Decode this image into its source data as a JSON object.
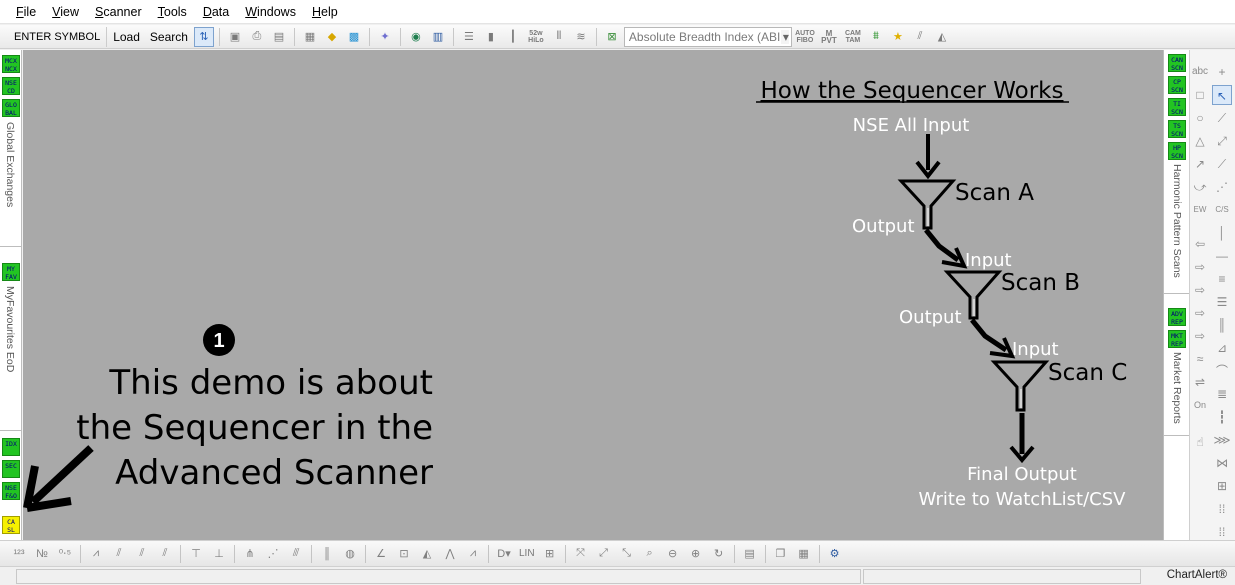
{
  "menu": {
    "items": [
      "File",
      "View",
      "Scanner",
      "Tools",
      "Data",
      "Windows",
      "Help"
    ]
  },
  "toolbar": {
    "symbol_label": "ENTER SYMBOL",
    "load_label": "Load",
    "search_label": "Search",
    "indicator_select": "Absolute Breadth Index (ABI",
    "small_icons": {
      "w52": "52w\nHiLo",
      "autofibo": "AUTO\nFIBO",
      "mpvt": "M\nPVT",
      "camtam": "CAM\nTAM"
    }
  },
  "left_panel": {
    "buttons": {
      "mcx": "MCX\nNCX",
      "nsecd": "NSE\nCD",
      "global": "GLO\nBAL",
      "myfav": "MY\nFAV",
      "idx": "IDX",
      "sec": "SEC",
      "nsefo": "NSE\nF&O",
      "casl": "CA\nSL"
    },
    "section_global": "Global Exchanges",
    "section_favourites": "MyFavourites EoD"
  },
  "right_panel": {
    "buttons": {
      "cnscn": "CAN\nSCN",
      "cpscn": "CP\nSCN",
      "tiscn": "TI\nSCN",
      "tsscn": "TS\nSCN",
      "hpscn": "HP\nSCN",
      "advrep": "ADV\nREP",
      "mktrep": "MKT\nREP"
    },
    "section_harmonic": "Harmonic Pattern Scans",
    "section_market": "Market Reports"
  },
  "canvas": {
    "step_number": "1",
    "demo_lines": [
      "This demo is about",
      "the Sequencer in the",
      "Advanced Scanner"
    ],
    "diagram": {
      "title": "How the Sequencer Works",
      "start_label": "NSE All Input",
      "scan_a": "Scan A",
      "scan_b": "Scan B",
      "scan_c": "Scan C",
      "output_label": "Output",
      "input_label": "Input",
      "final_line1": "Final Output",
      "final_line2": "Write to WatchList/CSV"
    }
  },
  "bottom_toolbar": {
    "lin_label": "LIN"
  },
  "status": {
    "brand": "ChartAlert®"
  },
  "colors": {
    "canvas_bg": "#a9a9a9",
    "shortcut_green": "#22c422",
    "shortcut_yellow": "#f6f000"
  }
}
